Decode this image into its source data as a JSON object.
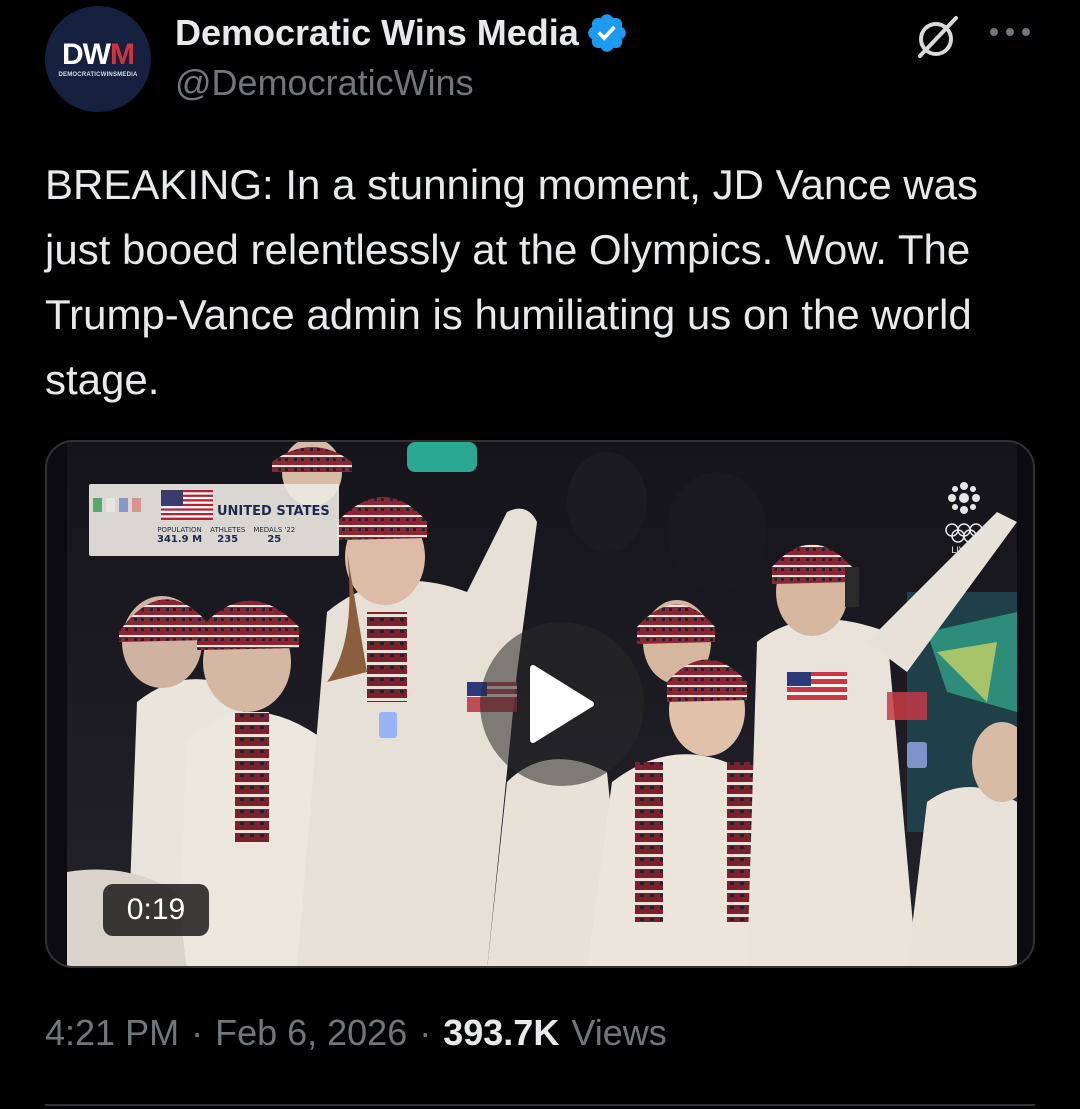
{
  "author": {
    "avatar_text_main": "DW",
    "avatar_text_accent": "M",
    "avatar_subtext": "DEMOCRATICWINSMEDIA",
    "display_name": "Democratic Wins Media",
    "handle": "@DemocraticWins",
    "verified": true
  },
  "icons": {
    "verified": "verified-badge-icon",
    "grok": "grok-icon",
    "more": "more-options-icon",
    "play": "play-icon"
  },
  "post": {
    "text": "BREAKING: In a stunning moment, JD Vance was just booed relentlessly at the Olympics. Wow. The Trump-Vance admin is humiliating us on the world stage."
  },
  "video": {
    "duration": "0:19",
    "lower_third": {
      "country": "UNITED STATES",
      "stats": [
        {
          "label": "POPULATION",
          "value": "341.9 M"
        },
        {
          "label": "ATHLETES",
          "value": "235"
        },
        {
          "label": "MEDALS '22",
          "value": "25"
        }
      ]
    },
    "broadcaster_badge": "LIVE"
  },
  "meta": {
    "time": "4:21 PM",
    "date": "Feb 6, 2026",
    "views_count": "393.7K",
    "views_label": "Views"
  },
  "colors": {
    "background": "#000000",
    "text_primary": "#e7e9ea",
    "text_secondary": "#71767b",
    "verified_blue": "#1d9bf0",
    "border": "#2f3336",
    "avatar_bg": "#15213f",
    "avatar_accent": "#d2333b"
  }
}
